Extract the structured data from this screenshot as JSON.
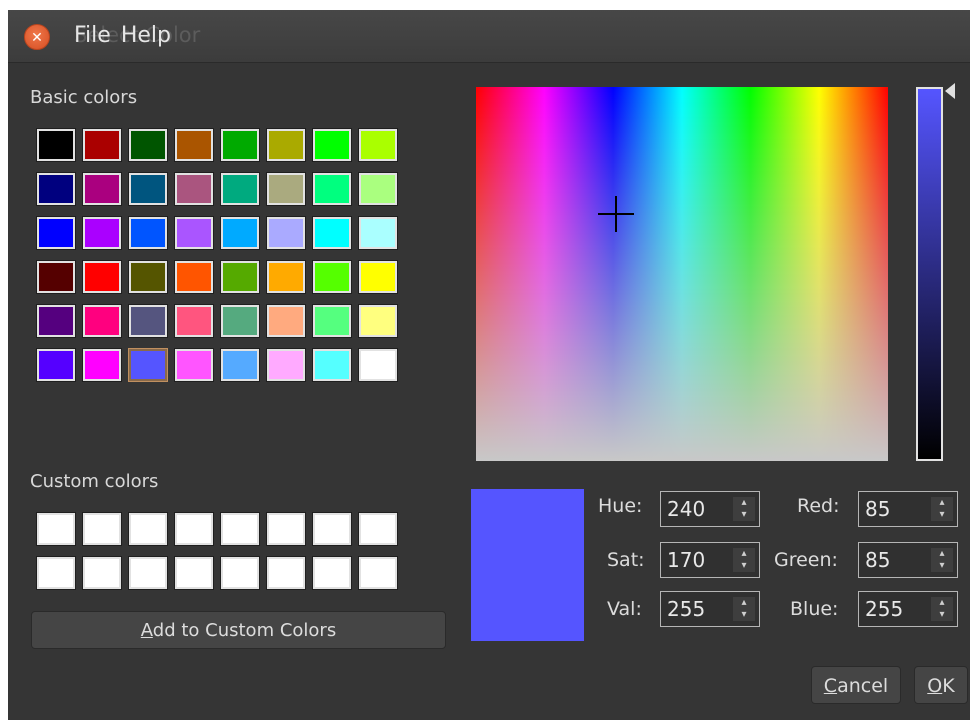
{
  "window": {
    "ghost_title": "Select Color",
    "menu": [
      "File",
      "Help"
    ]
  },
  "basic_colors": {
    "label": "Basic colors",
    "rows": [
      [
        "#000000",
        "#aa0000",
        "#005500",
        "#aa5500",
        "#00aa00",
        "#aaaa00",
        "#00ff00",
        "#aaff00"
      ],
      [
        "#00007f",
        "#aa007f",
        "#00557f",
        "#aa557f",
        "#00aa7f",
        "#aaaa7f",
        "#00ff7f",
        "#aaff7f"
      ],
      [
        "#0000ff",
        "#aa00ff",
        "#0055ff",
        "#aa55ff",
        "#00aaff",
        "#aaaaff",
        "#00ffff",
        "#aaffff"
      ],
      [
        "#550000",
        "#ff0000",
        "#555500",
        "#ff5500",
        "#55aa00",
        "#ffaa00",
        "#55ff00",
        "#ffff00"
      ],
      [
        "#55007f",
        "#ff007f",
        "#55557f",
        "#ff557f",
        "#55aa7f",
        "#ffaa7f",
        "#55ff7f",
        "#ffff7f"
      ],
      [
        "#5500ff",
        "#ff00ff",
        "#5555ff",
        "#ff55ff",
        "#55aaff",
        "#ffaaff",
        "#55ffff",
        "#ffffff"
      ]
    ],
    "selected": "#5555ff"
  },
  "custom_colors": {
    "label": "Custom colors",
    "rows": [
      [
        "#ffffff",
        "#ffffff",
        "#ffffff",
        "#ffffff",
        "#ffffff",
        "#ffffff",
        "#ffffff",
        "#ffffff"
      ],
      [
        "#ffffff",
        "#ffffff",
        "#ffffff",
        "#ffffff",
        "#ffffff",
        "#ffffff",
        "#ffffff",
        "#ffffff"
      ]
    ]
  },
  "add_button": {
    "mn": "A",
    "rest": "dd to Custom Colors"
  },
  "preview_color": "#5555ff",
  "fields": {
    "hue": {
      "label": "Hue:",
      "value": "240"
    },
    "sat": {
      "label": "Sat:",
      "value": "170"
    },
    "val": {
      "label": "Val:",
      "value": "255"
    },
    "red": {
      "label": "Red:",
      "value": "85"
    },
    "green": {
      "label": "Green:",
      "value": "85"
    },
    "blue": {
      "label": "Blue:",
      "value": "255"
    }
  },
  "buttons": {
    "cancel": {
      "mn": "C",
      "rest": "ancel"
    },
    "ok": {
      "mn": "O",
      "rest": "K"
    }
  }
}
